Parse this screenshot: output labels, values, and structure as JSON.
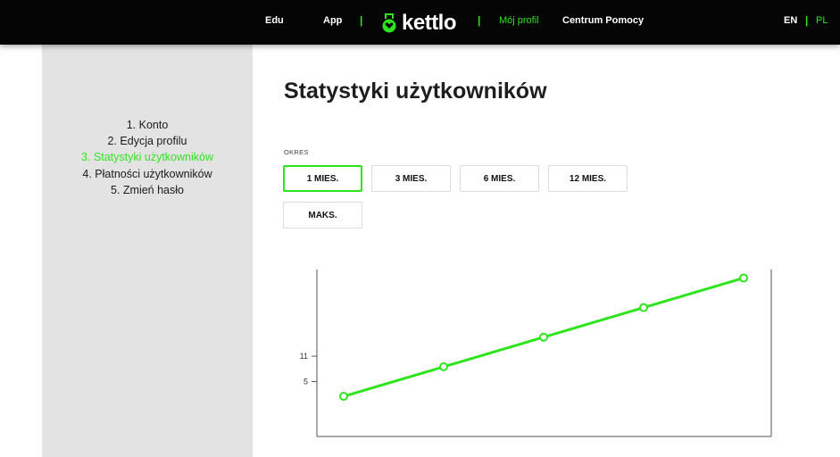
{
  "nav": {
    "edu": "Edu",
    "app": "App",
    "separator": "|",
    "logo_text": "kettlo",
    "my_profile": "Mój profil",
    "help_center": "Centrum Pomocy",
    "lang_en": "EN",
    "lang_pl": "PL"
  },
  "sidebar": {
    "items": [
      {
        "label": "1. Konto"
      },
      {
        "label": "2. Edycja profilu"
      },
      {
        "label": "3. Statystyki użytkowników"
      },
      {
        "label": "4. Płatności użytkowników"
      },
      {
        "label": "5. Zmień hasło"
      }
    ],
    "active_index": 2
  },
  "page": {
    "title": "Statystyki użytkowników",
    "period_label": "OKRES"
  },
  "periods": [
    {
      "label": "1 MIES.",
      "selected": true
    },
    {
      "label": "3 MIES.",
      "selected": false
    },
    {
      "label": "6 MIES.",
      "selected": false
    },
    {
      "label": "12 MIES.",
      "selected": false
    },
    {
      "label": "MAKS.",
      "selected": false
    }
  ],
  "colors": {
    "accent": "#2ee51d",
    "topbar": "#050505",
    "sidebar_bg": "#e3e3e3"
  },
  "chart_data": {
    "type": "line",
    "x": [
      1,
      2,
      3,
      4,
      5
    ],
    "series": [
      {
        "values": [
          1.5,
          8.5,
          15.5,
          22.5,
          29.5
        ]
      }
    ],
    "y_ticks": [
      5,
      11
    ],
    "ylim": [
      -8,
      31.5
    ],
    "grid": false,
    "title": "",
    "xlabel": "",
    "ylabel": ""
  }
}
